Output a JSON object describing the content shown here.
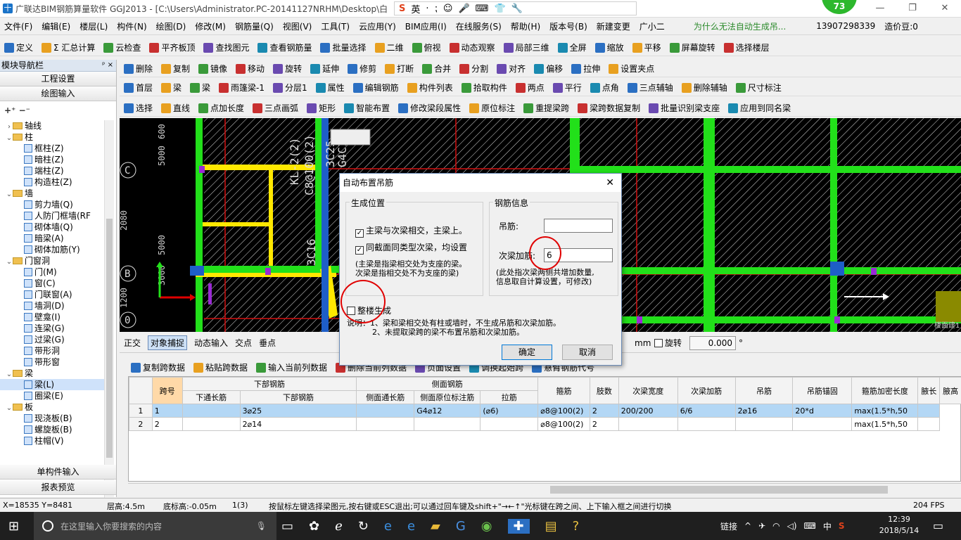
{
  "window": {
    "title": "广联达BIM钢筋算量软件 GGJ2013 - [C:\\Users\\Administrator.PC-20141127NRHM\\Desktop\\白"
  },
  "ime": {
    "items": [
      "英",
      "·",
      "⁏",
      "☺",
      "🎤",
      "⌨",
      "👕",
      "🔧"
    ]
  },
  "weather": {
    "value": "73"
  },
  "menubar": {
    "items": [
      "文件(F)",
      "编辑(E)",
      "楼层(L)",
      "构件(N)",
      "绘图(D)",
      "修改(M)",
      "钢筋量(Q)",
      "视图(V)",
      "工具(T)",
      "云应用(Y)",
      "BIM应用(I)",
      "在线服务(S)",
      "帮助(H)",
      "版本号(B)",
      "新建变更",
      "广小二",
      "为什么无法自动生成吊...",
      "13907298339",
      "造价豆:0"
    ]
  },
  "toolbar1": {
    "items": [
      "定义",
      "Σ 汇总计算",
      "云检查",
      "平齐板顶",
      "查找图元",
      "查看钢筋量",
      "批量选择",
      "二维",
      "俯视",
      "动态观察",
      "局部三维",
      "全屏",
      "缩放",
      "平移",
      "屏幕旋转",
      "选择楼层"
    ]
  },
  "toolbar2": {
    "items": [
      "删除",
      "复制",
      "镜像",
      "移动",
      "旋转",
      "延伸",
      "修剪",
      "打断",
      "合并",
      "分割",
      "对齐",
      "偏移",
      "拉伸",
      "设置夹点"
    ]
  },
  "toolbar3": {
    "items": [
      "首层",
      "梁",
      "梁",
      "雨篷梁-1",
      "分层1",
      "属性",
      "编辑钢筋",
      "构件列表",
      "拾取构件",
      "两点",
      "平行",
      "点角",
      "三点辅轴",
      "删除辅轴",
      "尺寸标注"
    ]
  },
  "toolbar4": {
    "items": [
      "选择",
      "直线",
      "点加长度",
      "三点画弧",
      "矩形",
      "智能布置",
      "修改梁段属性",
      "原位标注",
      "重提梁跨",
      "梁跨数据复制",
      "批量识别梁支座",
      "应用到同名梁"
    ]
  },
  "sidebar": {
    "title": "模块导航栏",
    "pin": "ᵖ ×",
    "btn_settings": "工程设置",
    "btn_draw": "绘图输入",
    "tree": [
      {
        "label": "轴线",
        "type": "folder",
        "indent": 0,
        "exp": "›"
      },
      {
        "label": "柱",
        "type": "folder",
        "indent": 0,
        "exp": "⌄"
      },
      {
        "label": "框柱(Z)",
        "type": "leaf",
        "indent": 1
      },
      {
        "label": "暗柱(Z)",
        "type": "leaf",
        "indent": 1
      },
      {
        "label": "端柱(Z)",
        "type": "leaf",
        "indent": 1
      },
      {
        "label": "构造柱(Z)",
        "type": "leaf",
        "indent": 1
      },
      {
        "label": "墙",
        "type": "folder",
        "indent": 0,
        "exp": "⌄"
      },
      {
        "label": "剪力墙(Q)",
        "type": "leaf",
        "indent": 1
      },
      {
        "label": "人防门框墙(RF",
        "type": "leaf",
        "indent": 1
      },
      {
        "label": "砌体墙(Q)",
        "type": "leaf",
        "indent": 1
      },
      {
        "label": "暗梁(A)",
        "type": "leaf",
        "indent": 1
      },
      {
        "label": "砌体加筋(Y)",
        "type": "leaf",
        "indent": 1
      },
      {
        "label": "门窗洞",
        "type": "folder",
        "indent": 0,
        "exp": "⌄"
      },
      {
        "label": "门(M)",
        "type": "leaf",
        "indent": 1
      },
      {
        "label": "窗(C)",
        "type": "leaf",
        "indent": 1
      },
      {
        "label": "门联窗(A)",
        "type": "leaf",
        "indent": 1
      },
      {
        "label": "墙洞(D)",
        "type": "leaf",
        "indent": 1
      },
      {
        "label": "壁龛(I)",
        "type": "leaf",
        "indent": 1
      },
      {
        "label": "连梁(G)",
        "type": "leaf",
        "indent": 1
      },
      {
        "label": "过梁(G)",
        "type": "leaf",
        "indent": 1
      },
      {
        "label": "带形洞",
        "type": "leaf",
        "indent": 1
      },
      {
        "label": "带形窗",
        "type": "leaf",
        "indent": 1
      },
      {
        "label": "梁",
        "type": "folder",
        "indent": 0,
        "exp": "⌄"
      },
      {
        "label": "梁(L)",
        "type": "leaf",
        "indent": 1
      },
      {
        "label": "圈梁(E)",
        "type": "leaf",
        "indent": 1
      },
      {
        "label": "板",
        "type": "folder",
        "indent": 0,
        "exp": "⌄"
      },
      {
        "label": "现浇板(B)",
        "type": "leaf",
        "indent": 1
      },
      {
        "label": "螺旋板(B)",
        "type": "leaf",
        "indent": 1
      },
      {
        "label": "柱帽(V)",
        "type": "leaf",
        "indent": 1
      }
    ],
    "btn_single": "单构件输入",
    "btn_report": "报表预览"
  },
  "canvas": {
    "axis_labels": [
      "C",
      "B",
      "0"
    ],
    "dims": [
      "600",
      "5000",
      "2080",
      "5000",
      "3000",
      "1200"
    ],
    "beam_texts": [
      "KL-2(2)",
      "C8@100(2)",
      "3C16"
    ],
    "beam_texts_right": [
      "3C25",
      "G4C12"
    ],
    "corner": "楼面建1"
  },
  "snapbar": {
    "items": [
      "正交",
      "对象捕捉",
      "动态输入",
      "交点",
      "垂点"
    ],
    "mm_label": "mm",
    "rotate_label": "旋转",
    "rotate_value": "0.000",
    "degree": "°"
  },
  "gridtool": {
    "items": [
      "复制跨数据",
      "粘贴跨数据",
      "输入当前列数据",
      "删除当前列数据",
      "页面设置",
      "调换起始跨",
      "悬臂钢筋代号"
    ]
  },
  "grid": {
    "group_headers": {
      "bottom": "下部钢筋",
      "side": "侧面钢筋"
    },
    "headers": [
      "跨号",
      "下通长筋",
      "下部钢筋",
      "侧面通长筋",
      "侧面原位标注筋",
      "拉筋",
      "箍筋",
      "肢数",
      "次梁宽度",
      "次梁加筋",
      "吊筋",
      "吊筋锚固",
      "箍筋加密长度",
      "腋长",
      "腋高"
    ],
    "rows": [
      [
        "1",
        "1",
        "",
        "3⌀25",
        "",
        "G4⌀12",
        "(⌀6)",
        "⌀8@100(2)",
        "2",
        "200/200",
        "6/6",
        "2⌀16",
        "20*d",
        "max(1.5*h,50",
        ""
      ],
      [
        "2",
        "2",
        "",
        "2⌀14",
        "",
        "",
        "",
        "⌀8@100(2)",
        "2",
        "",
        "",
        "",
        "",
        "max(1.5*h,50",
        ""
      ]
    ]
  },
  "dialog": {
    "title": "自动布置吊筋",
    "close": "✕",
    "group_position": "生成位置",
    "opt1": "主梁与次梁相交，主梁上。",
    "opt2": "同截面同类型次梁，均设置",
    "note1": "(主梁是指梁相交处为支座的梁。",
    "note2": "次梁是指相交处不为支座的梁)",
    "group_info": "钢筋信息",
    "label_hanging": "吊筋:",
    "value_hanging": "",
    "label_secondary": "次梁加筋:",
    "value_secondary": "6",
    "note3": "(此处指次梁两侧共增加数量,",
    "note4": "信息取自计算设置，可修改)",
    "whole_building": "整楼生成",
    "explain1": "说明：1、梁和梁相交处有柱或墙时，不生成吊筋和次梁加筋。",
    "explain2": "2、未提取梁跨的梁不布置吊筋和次梁加筋。",
    "ok": "确定",
    "cancel": "取消"
  },
  "statusbar": {
    "coords": "X=18535 Y=8481",
    "floor_height": "层高:4.5m",
    "base_height": "底标高:-0.05m",
    "count": "1(3)",
    "hint": "按鼠标左键选择梁图元,按右键或ESC退出;可以通过回车键及shift+\"→←↑\"光标键在跨之间、上下输入框之间进行切换",
    "fps": "204 FPS"
  },
  "taskbar": {
    "search": "在这里输入你要搜索的内容",
    "link": "链接",
    "ime": "中",
    "time": "12:39",
    "date": "2018/5/14"
  },
  "colors": {
    "canvas_bg": "#000000",
    "beam_green": "#22e01a",
    "beam_yellow": "#ffe800",
    "grid_red": "#d41010",
    "accent": "#0078d7"
  }
}
